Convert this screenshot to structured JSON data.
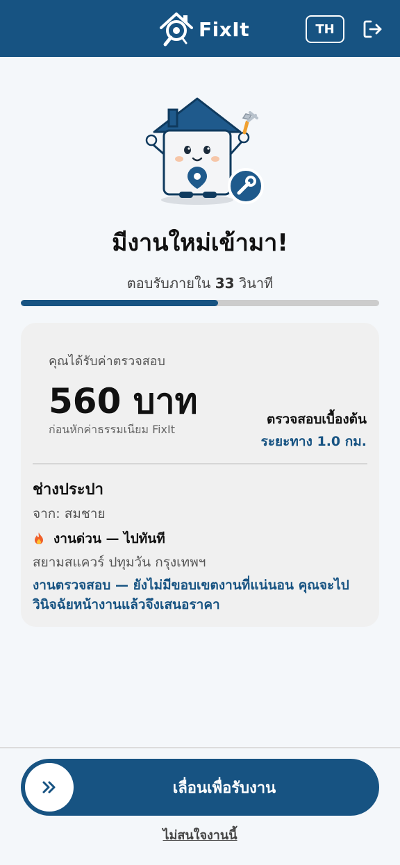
{
  "header": {
    "brand_name": "FixIt",
    "language_button": "TH",
    "logout_icon": "logout-icon"
  },
  "alert": {
    "headline": "มีงานใหม่เข้ามา!",
    "countdown_prefix": "ตอบรับภายใน",
    "countdown_seconds": "33",
    "countdown_suffix": "วินาที",
    "progress_fraction": 0.55
  },
  "job": {
    "earn_label": "คุณได้รับค่าตรวจสอบ",
    "earn_amount": "560 บาท",
    "earn_note": "ก่อนหักค่าธรรมเนียม FixIt",
    "job_type": "ตรวจสอบเบื้องต้น",
    "distance": "ระยะทาง 1.0 กม.",
    "category": "ช่างประปา",
    "from_label": "จาก:",
    "from_name": "สมชาย",
    "urgent_label": "งานด่วน — ไปทันที",
    "location": "สยามสแควร์ ปทุมวัน กรุงเทพฯ",
    "inspection_note": "งานตรวจสอบ — ยังไม่มีขอบเขตงานที่แน่นอน คุณจะไปวินิจฉัยหน้างานแล้วจึงเสนอราคา"
  },
  "actions": {
    "slide_label": "เลื่อนเพื่อรับงาน",
    "decline_label": "ไม่สนใจงานนี้"
  },
  "colors": {
    "primary": "#175382",
    "accent": "#f0a030"
  }
}
